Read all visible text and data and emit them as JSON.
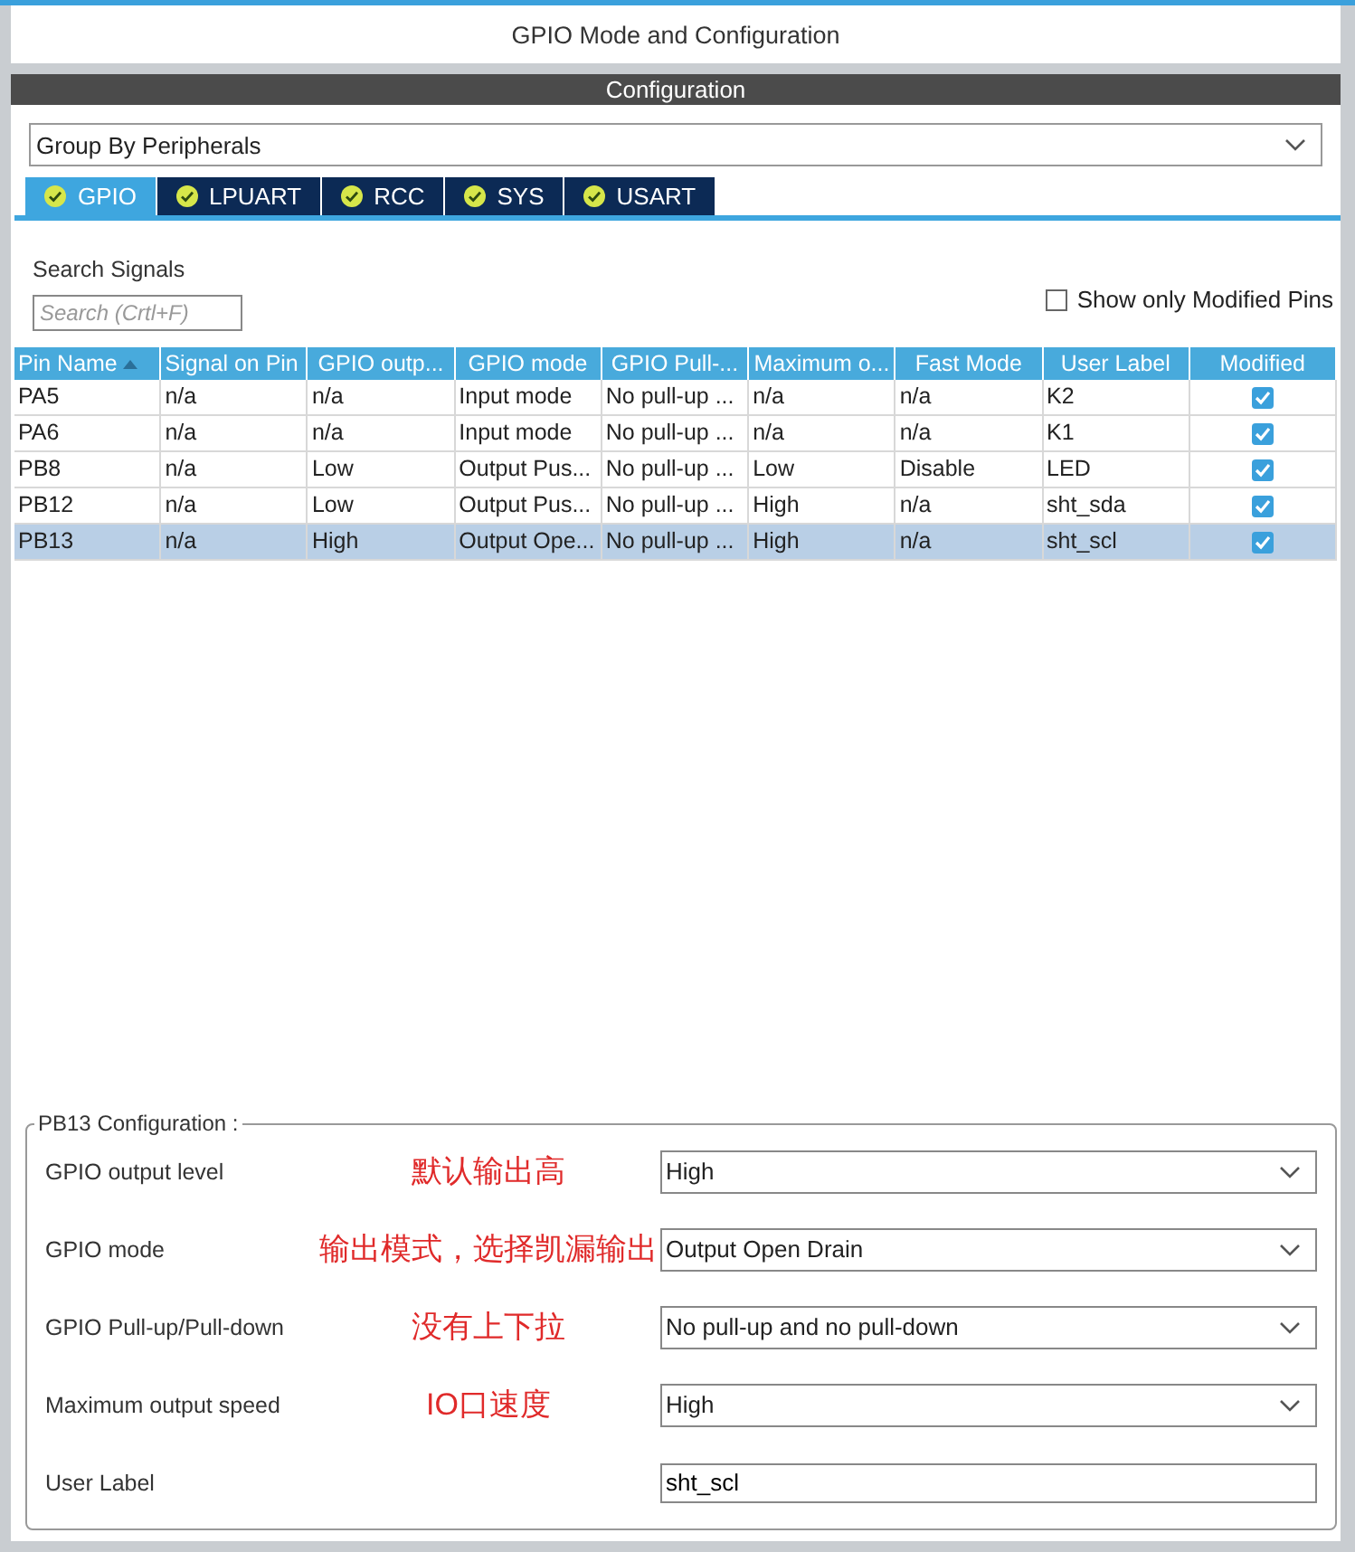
{
  "window": {
    "title": "GPIO Mode and Configuration"
  },
  "section_header": "Configuration",
  "group_by": {
    "value": "Group By Peripherals"
  },
  "tabs": [
    {
      "label": "GPIO",
      "selected": true
    },
    {
      "label": "LPUART",
      "selected": false
    },
    {
      "label": "RCC",
      "selected": false
    },
    {
      "label": "SYS",
      "selected": false
    },
    {
      "label": "USART",
      "selected": false
    }
  ],
  "search": {
    "label": "Search Signals",
    "placeholder": "Search (Crtl+F)"
  },
  "show_only_modified": {
    "label": "Show only Modified Pins",
    "checked": false
  },
  "table": {
    "columns": [
      {
        "label": "Pin Name",
        "sorted": true
      },
      {
        "label": "Signal on Pin",
        "sorted": false
      },
      {
        "label": "GPIO outp...",
        "sorted": false
      },
      {
        "label": "GPIO mode",
        "sorted": false
      },
      {
        "label": "GPIO Pull-...",
        "sorted": false
      },
      {
        "label": "Maximum o...",
        "sorted": false
      },
      {
        "label": "Fast Mode",
        "sorted": false
      },
      {
        "label": "User Label",
        "sorted": false
      },
      {
        "label": "Modified",
        "sorted": false
      }
    ],
    "rows": [
      {
        "cells": [
          "PA5",
          "n/a",
          "n/a",
          "Input mode",
          "No pull-up ...",
          "n/a",
          "n/a",
          "K2"
        ],
        "modified": true,
        "selected": false
      },
      {
        "cells": [
          "PA6",
          "n/a",
          "n/a",
          "Input mode",
          "No pull-up ...",
          "n/a",
          "n/a",
          "K1"
        ],
        "modified": true,
        "selected": false
      },
      {
        "cells": [
          "PB8",
          "n/a",
          "Low",
          "Output Pus...",
          "No pull-up ...",
          "Low",
          "Disable",
          "LED"
        ],
        "modified": true,
        "selected": false
      },
      {
        "cells": [
          "PB12",
          "n/a",
          "Low",
          "Output Pus...",
          "No pull-up ...",
          "High",
          "n/a",
          "sht_sda"
        ],
        "modified": true,
        "selected": false
      },
      {
        "cells": [
          "PB13",
          "n/a",
          "High",
          "Output Ope...",
          "No pull-up ...",
          "High",
          "n/a",
          "sht_scl"
        ],
        "modified": true,
        "selected": true
      }
    ]
  },
  "pin_config": {
    "title": "PB13 Configuration :",
    "fields": [
      {
        "label": "GPIO output level",
        "kind": "dropdown",
        "value": "High",
        "annotation": "默认输出高"
      },
      {
        "label": "GPIO mode",
        "kind": "dropdown",
        "value": "Output Open Drain",
        "annotation": "输出模式，选择凯漏输出"
      },
      {
        "label": "GPIO Pull-up/Pull-down",
        "kind": "dropdown",
        "value": "No pull-up and no pull-down",
        "annotation": "没有上下拉"
      },
      {
        "label": "Maximum output speed",
        "kind": "dropdown",
        "value": "High",
        "annotation": "IO口速度"
      },
      {
        "label": "User Label",
        "kind": "text",
        "value": "sht_scl"
      }
    ]
  }
}
